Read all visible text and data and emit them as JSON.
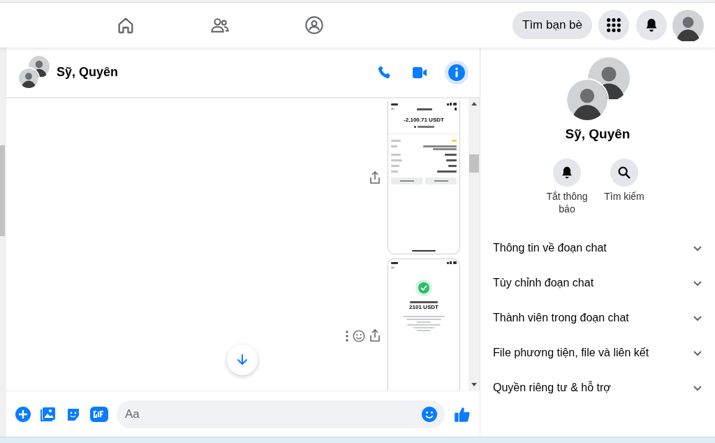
{
  "top_nav": {
    "tabs": [
      {
        "kind": "home",
        "selected": false
      },
      {
        "kind": "friends",
        "selected": false
      },
      {
        "kind": "groups",
        "selected": false
      }
    ],
    "find_friends": "Tìm bạn bè"
  },
  "chat": {
    "title": "Sỹ, Quyên",
    "messages": [
      {
        "kind": "screenshot_withdraw_info",
        "amount": "-2,100.71 USDT"
      },
      {
        "kind": "screenshot_processing",
        "amount": "2101 USDT"
      }
    ],
    "composer": {
      "placeholder": "Aa"
    }
  },
  "info_panel": {
    "name": "Sỹ, Quyên",
    "actions": [
      {
        "kind": "mute",
        "label": "Tắt thông báo"
      },
      {
        "kind": "search",
        "label": "Tìm kiếm"
      }
    ],
    "sections": [
      {
        "label": "Thông tin về đoạn chat",
        "expanded": false
      },
      {
        "label": "Tùy chỉnh đoạn chat",
        "expanded": false
      },
      {
        "label": "Thành viên trong đoạn chat",
        "expanded": false
      },
      {
        "label": "File phương tiện, file và liên kết",
        "expanded": false
      },
      {
        "label": "Quyền riêng tư & hỗ trợ",
        "expanded": false
      }
    ]
  }
}
